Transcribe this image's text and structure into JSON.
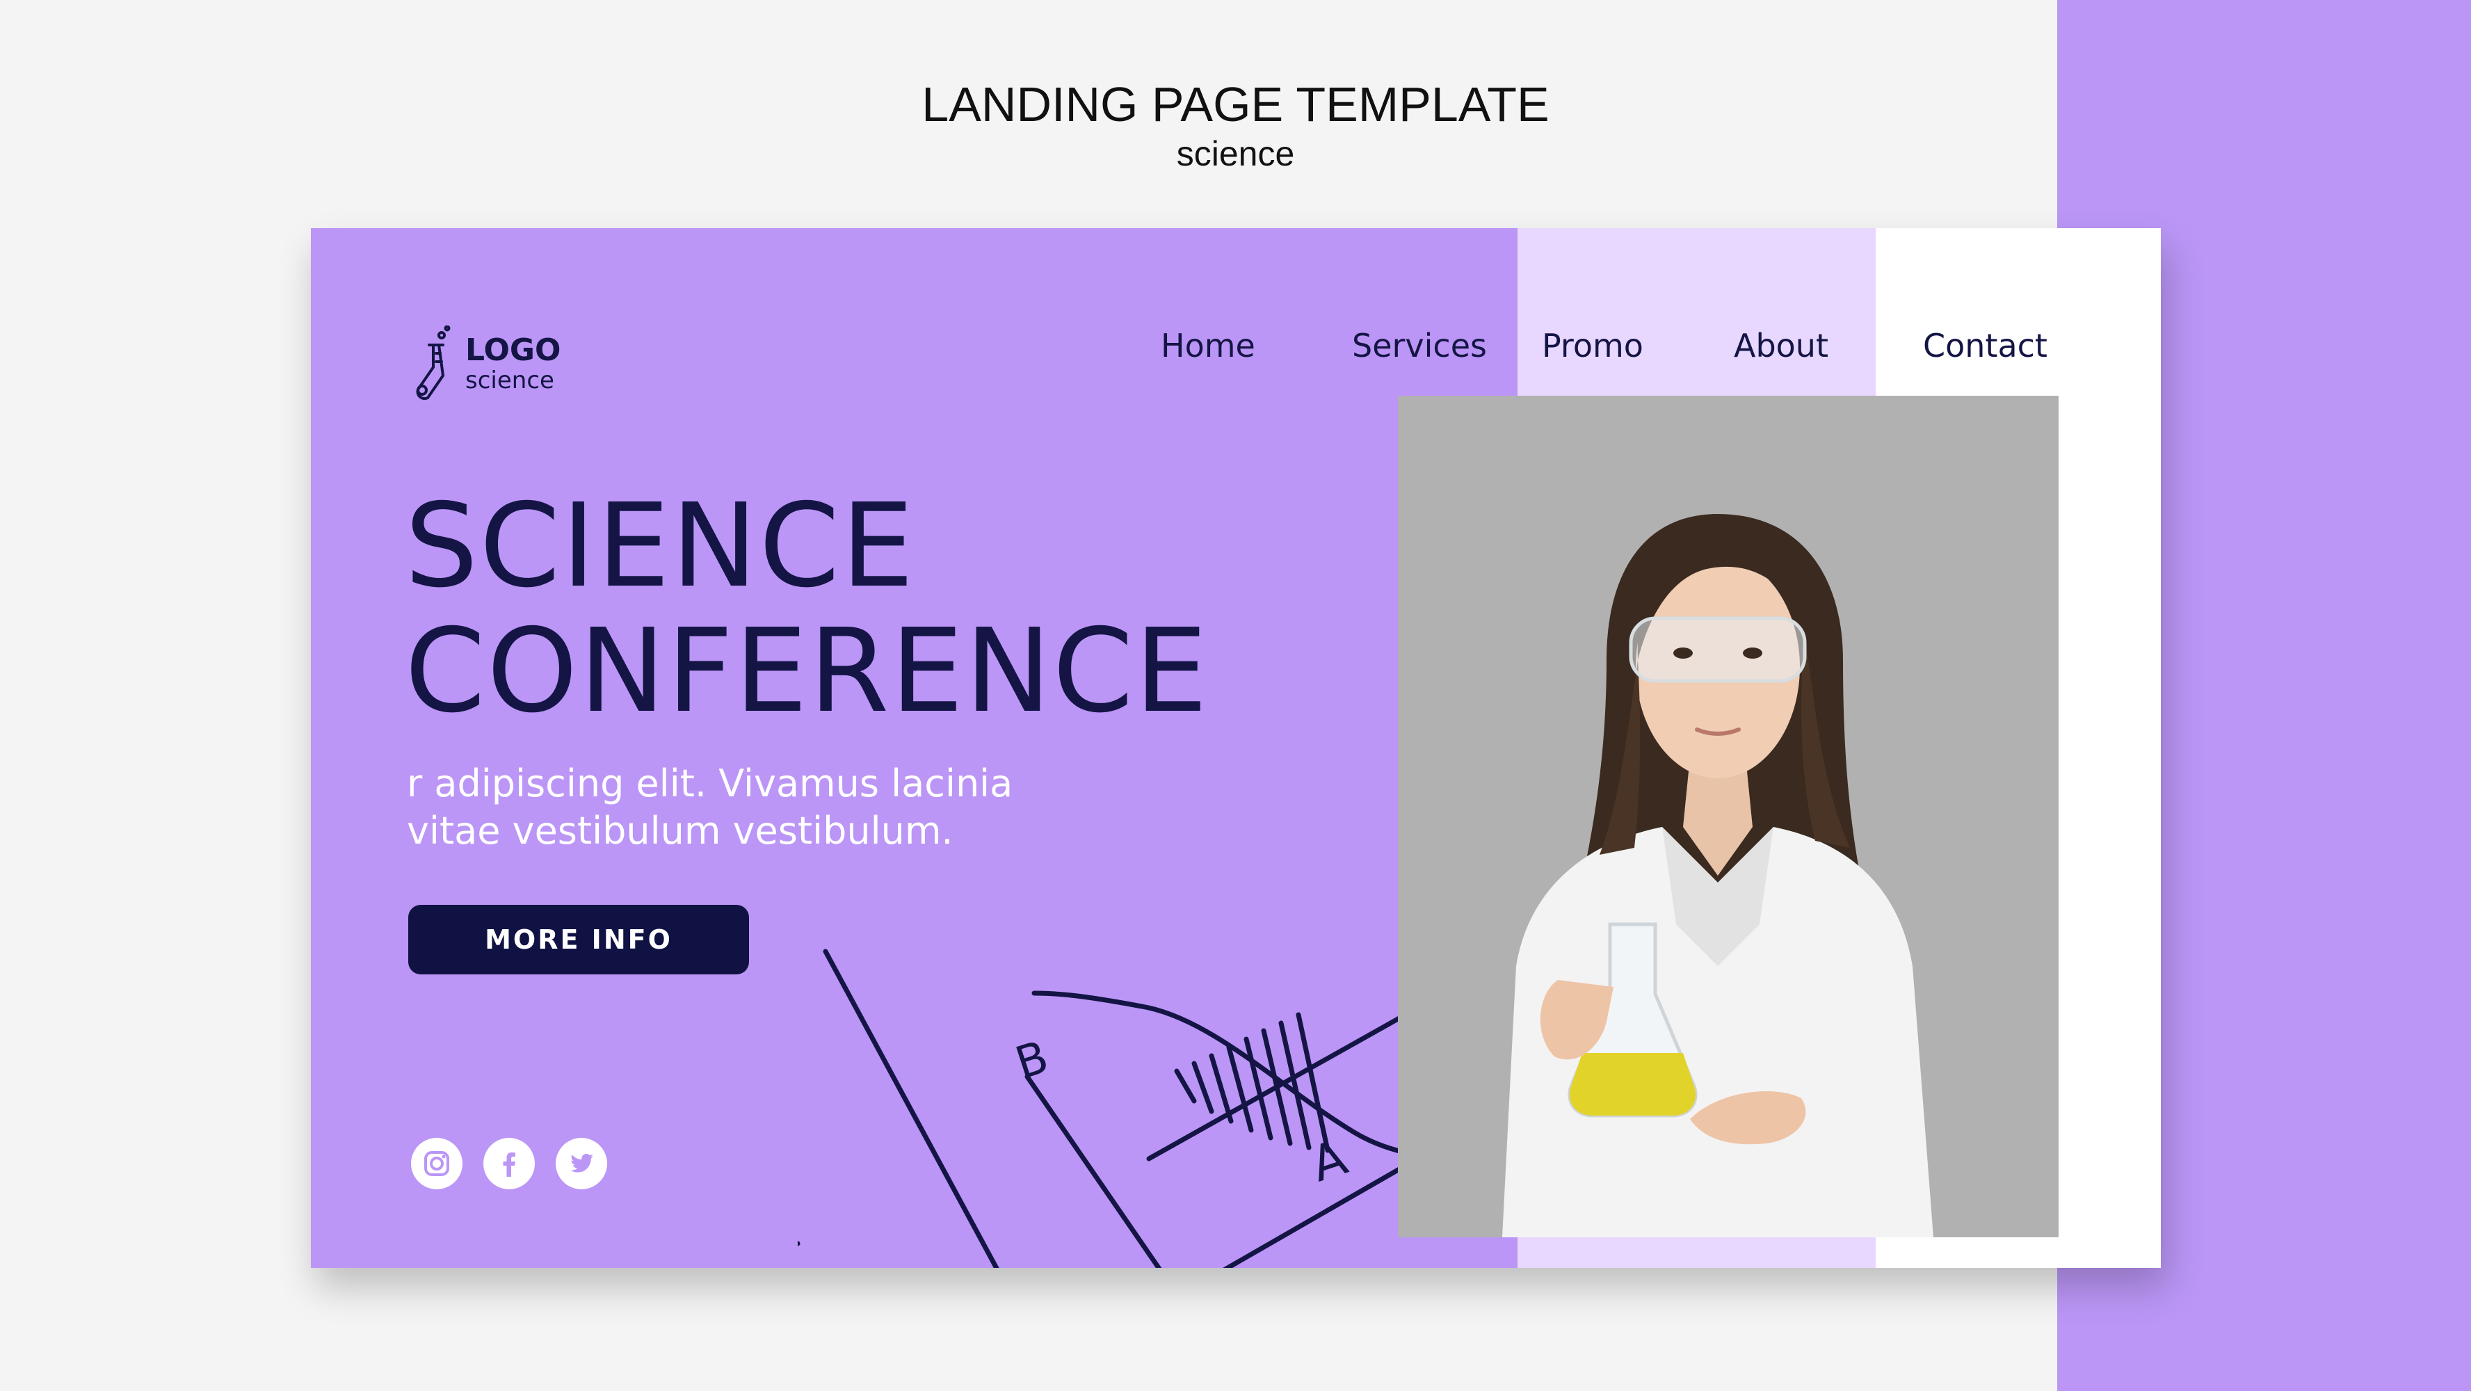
{
  "header": {
    "title": "LANDING PAGE TEMPLATE",
    "subtitle": "science"
  },
  "logo": {
    "main": "LOGO",
    "sub": "science"
  },
  "nav": {
    "home": "Home",
    "services": "Services",
    "promo": "Promo",
    "about": "About",
    "contact": "Contact"
  },
  "hero": {
    "title_line1": "SCIENCE",
    "title_line2": "CONFERENCE",
    "text_line1": "r adipiscing elit. Vivamus lacinia",
    "text_line2": "vitae vestibulum vestibulum.",
    "cta": "MORE INFO"
  },
  "decoration": {
    "label_a": "A",
    "label_b": "B"
  },
  "social": [
    "instagram-icon",
    "facebook-icon",
    "twitter-icon"
  ],
  "colors": {
    "purple": "#bb96f6",
    "lilac": "#e8d7fe",
    "navy": "#101244",
    "photo_bg": "#b1b1b1"
  }
}
